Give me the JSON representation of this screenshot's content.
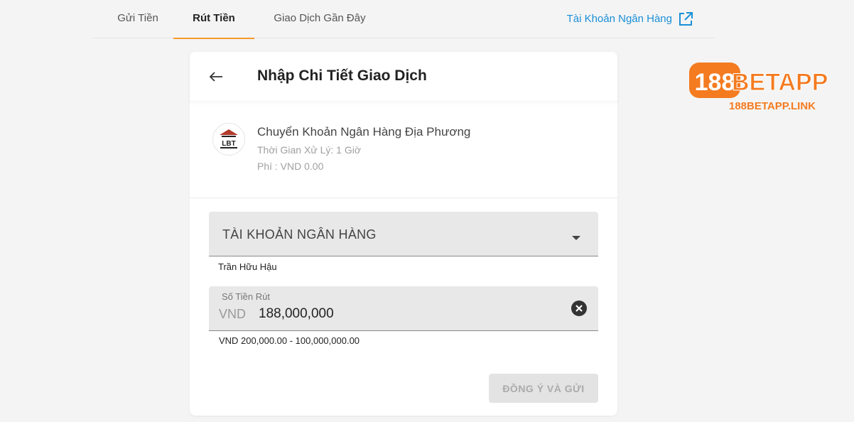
{
  "tabs": [
    {
      "label": "Gửi Tiền"
    },
    {
      "label": "Rút Tiền"
    },
    {
      "label": "Giao Dịch Gần Đây"
    }
  ],
  "bank_account_link": "Tài Khoản Ngân Hàng",
  "card": {
    "title": "Nhập Chi Tiết Giao Dịch",
    "method": {
      "logo_text": "LBT",
      "name": "Chuyển Khoản Ngân Hàng Địa Phương",
      "processing_time": "Thời Gian Xử Lý: 1 Giờ",
      "fee": "Phí : VND 0.00"
    },
    "bank_select": {
      "label": "TÀI KHOẢN NGÂN HÀNG",
      "helper": "Trần Hữu Hậu"
    },
    "amount": {
      "label": "Số Tiền Rút",
      "prefix": "VND",
      "value": "188,000,000",
      "helper": "VND 200,000.00 - 100,000,000.00"
    },
    "submit_label": "ĐỒNG Ý VÀ GỬI"
  },
  "watermark": {
    "brand_number": "188",
    "brand_text": "BETAPP",
    "url": "188BETAPP.LINK"
  },
  "colors": {
    "accent": "#f39a2b",
    "link": "#1a8fd8",
    "brand_orange": "#f47b20"
  },
  "icons": {
    "bank_link": "external-link-icon",
    "back": "arrow-left-icon",
    "select": "caret-down-icon",
    "clear": "clear-circle-icon"
  }
}
